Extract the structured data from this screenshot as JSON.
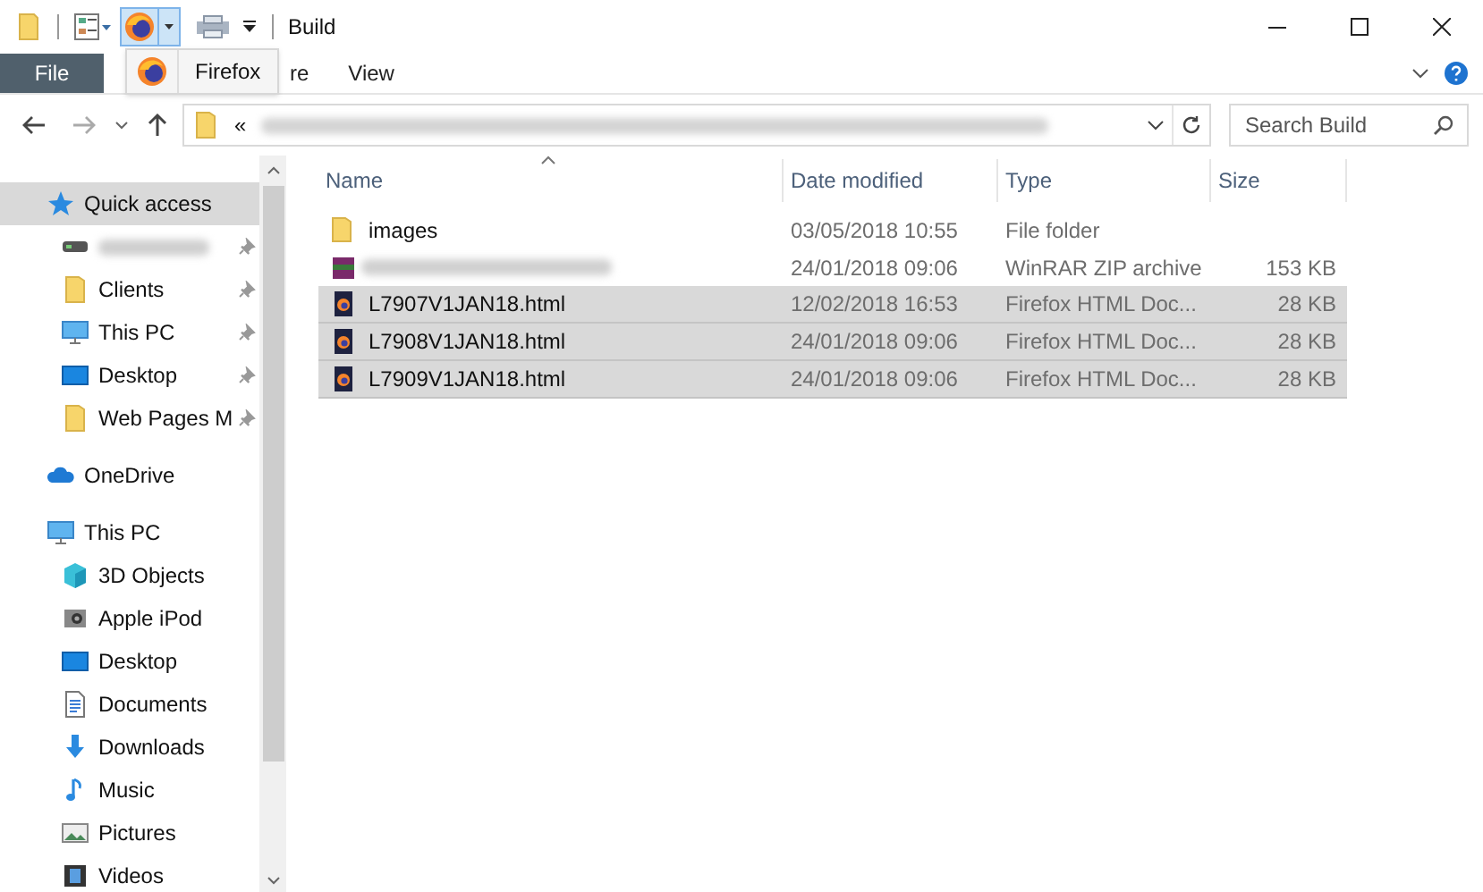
{
  "window": {
    "title": "Build"
  },
  "tooltip": {
    "label": "Firefox"
  },
  "ribbon_tabs": [
    {
      "label": "File",
      "kind": "file"
    },
    {
      "label": "re",
      "kind": "tab"
    },
    {
      "label": "View",
      "kind": "tab"
    }
  ],
  "address": {
    "prefix": "«"
  },
  "search": {
    "placeholder": "Search Build"
  },
  "sidebar": {
    "items": [
      {
        "label": "Quick access",
        "kind": "star",
        "selected": true,
        "children": [
          {
            "kind": "drive",
            "pinned": true,
            "selected": false
          },
          {
            "label": "Clients",
            "kind": "folder",
            "pinned": true,
            "selected": false
          },
          {
            "label": "This PC",
            "kind": "pc",
            "pinned": true,
            "selected": false
          },
          {
            "label": "Desktop",
            "kind": "desktop",
            "pinned": true,
            "selected": false
          },
          {
            "label": "Web Pages M",
            "kind": "folder",
            "pinned": true,
            "selected": false
          }
        ]
      },
      {
        "label": "OneDrive",
        "kind": "cloud",
        "selected": false
      },
      {
        "label": "This PC",
        "kind": "pc",
        "selected": false,
        "children": [
          {
            "label": "3D Objects",
            "kind": "cube",
            "selected": false
          },
          {
            "label": "Apple iPod",
            "kind": "ipod",
            "selected": false
          },
          {
            "label": "Desktop",
            "kind": "desktop",
            "selected": false
          },
          {
            "label": "Documents",
            "kind": "docs",
            "selected": false
          },
          {
            "label": "Downloads",
            "kind": "down",
            "selected": false
          },
          {
            "label": "Music",
            "kind": "music",
            "selected": false
          },
          {
            "label": "Pictures",
            "kind": "pics",
            "selected": false
          },
          {
            "label": "Videos",
            "kind": "video",
            "selected": false
          }
        ]
      }
    ]
  },
  "table": {
    "columns": [
      "Name",
      "Date modified",
      "Type",
      "Size"
    ],
    "rows": [
      {
        "kind": "folder",
        "name": "images",
        "date": "03/05/2018 10:55",
        "type": "File folder",
        "selected": false
      },
      {
        "kind": "zip",
        "date": "24/01/2018 09:06",
        "type": "WinRAR ZIP archive",
        "size": "153 KB",
        "selected": false
      },
      {
        "kind": "html",
        "name": "L7907V1JAN18.html",
        "date": "12/02/2018 16:53",
        "type": "Firefox HTML Doc...",
        "size": "28 KB",
        "selected": true
      },
      {
        "kind": "html",
        "name": "L7908V1JAN18.html",
        "date": "24/01/2018 09:06",
        "type": "Firefox HTML Doc...",
        "size": "28 KB",
        "selected": true
      },
      {
        "kind": "html",
        "name": "L7909V1JAN18.html",
        "date": "24/01/2018 09:06",
        "type": "Firefox HTML Doc...",
        "size": "28 KB",
        "selected": true
      }
    ]
  }
}
